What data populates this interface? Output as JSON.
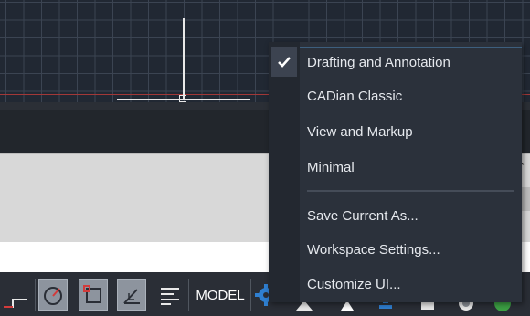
{
  "status_bar": {
    "model_label": "MODEL"
  },
  "workspace_menu": {
    "items": [
      {
        "label": "Drafting and Annotation",
        "checked": true
      },
      {
        "label": "CADian Classic",
        "checked": false
      },
      {
        "label": "View and Markup",
        "checked": false
      },
      {
        "label": "Minimal",
        "checked": false
      }
    ],
    "actions": [
      {
        "label": "Save Current As..."
      },
      {
        "label": "Workspace Settings..."
      },
      {
        "label": "Customize UI..."
      }
    ]
  },
  "colors": {
    "canvas_bg": "#212833",
    "grid_line": "#3b4452",
    "x_axis": "#a23838",
    "menu_bg": "#2b313b",
    "status_bar_bg": "#2a2e36",
    "command_panel_bg": "#d8d8d8"
  },
  "icons": [
    "checkmark-icon",
    "polar-tracking-icon",
    "object-snap-icon",
    "dynamic-ucs-icon",
    "lineweight-icon",
    "workspace-gear-icon",
    "annotation-icon",
    "isolate-icon",
    "hardware-icon",
    "notification-icon"
  ]
}
